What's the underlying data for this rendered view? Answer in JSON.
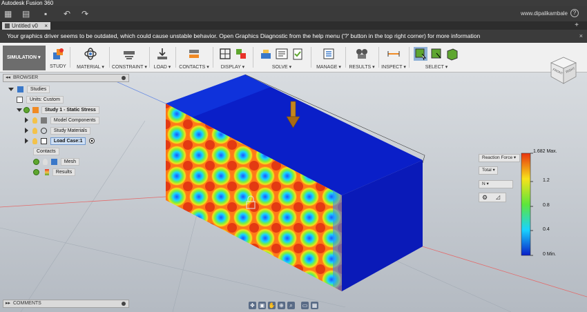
{
  "window_title": "Autodesk Fusion 360",
  "appbar": {
    "user": "www.dipalikambale",
    "help": "?"
  },
  "tab": {
    "label": "Untitled v0",
    "close": "×",
    "plus": "+"
  },
  "warning": {
    "text": "Your graphics driver seems to be outdated, which could cause unstable behavior. Open Graphics Diagnostic from the help menu ('?' button in the top right corner) for more information",
    "close": "×"
  },
  "toolbar": {
    "workspace": "SIMULATION ▾",
    "groups": [
      "STUDY",
      "MATERIAL ▾",
      "CONSTRAINT ▾",
      "LOAD ▾",
      "CONTACTS ▾",
      "DISPLAY ▾",
      "SOLVE ▾",
      "MANAGE ▾",
      "RESULTS ▾",
      "INSPECT ▾",
      "SELECT ▾"
    ]
  },
  "browser": {
    "title": "BROWSER",
    "items": [
      {
        "label": "Studies"
      },
      {
        "label": "Units: Custom"
      },
      {
        "label": "Study 1 - Static Stress"
      },
      {
        "label": "Model Components"
      },
      {
        "label": "Study Materials"
      },
      {
        "label": "Load Case:1"
      },
      {
        "label": "Contacts"
      },
      {
        "label": "Mesh"
      },
      {
        "label": "Results"
      }
    ]
  },
  "comments": {
    "title": "COMMENTS"
  },
  "result_panel": {
    "type": "Reaction Force ▾",
    "component": "Total ▾",
    "unit": "N ▾"
  },
  "legend": {
    "labels": [
      "1.682 Max.",
      "1.2",
      "0.8",
      "0.4",
      "0 Min."
    ]
  },
  "viewcube": {
    "front": "FRONT",
    "right": "RIGHT"
  },
  "colors": {
    "accent": "#5ea62f",
    "model_blue": "#0a1fc8",
    "legend_top": "#e8320e"
  }
}
